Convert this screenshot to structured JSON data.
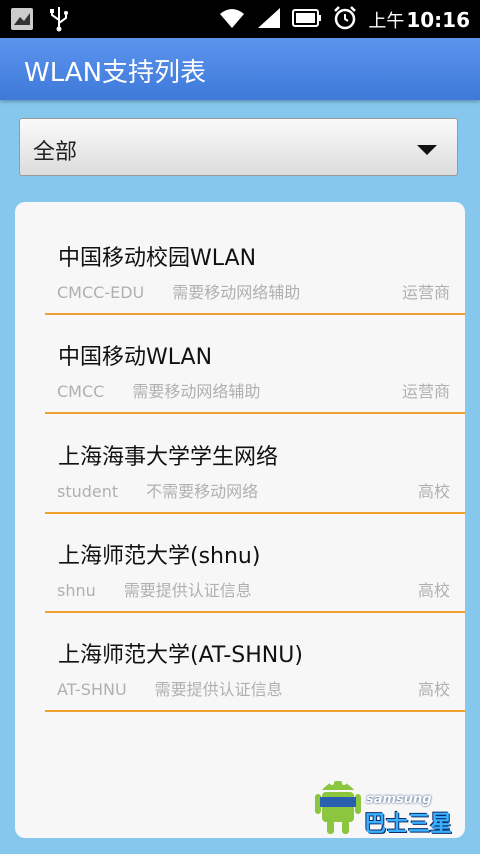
{
  "status_bar": {
    "ampm": "上午",
    "time": "10:16",
    "icons": [
      "notification-icon",
      "usb-icon",
      "wifi-icon",
      "signal-icon",
      "battery-icon",
      "alarm-icon"
    ]
  },
  "header": {
    "title": "WLAN支持列表"
  },
  "filter": {
    "selected": "全部"
  },
  "networks": [
    {
      "name": "中国移动校园WLAN",
      "ssid": "CMCC-EDU",
      "desc": "需要移动网络辅助",
      "type": "运营商"
    },
    {
      "name": "中国移动WLAN",
      "ssid": "CMCC",
      "desc": "需要移动网络辅助",
      "type": "运营商"
    },
    {
      "name": "上海海事大学学生网络",
      "ssid": "student",
      "desc": "不需要移动网络",
      "type": "高校"
    },
    {
      "name": "上海师范大学(shnu)",
      "ssid": "shnu",
      "desc": "需要提供认证信息",
      "type": "高校"
    },
    {
      "name": "上海师范大学(AT-SHNU)",
      "ssid": "AT-SHNU",
      "desc": "需要提供认证信息",
      "type": "高校"
    }
  ],
  "watermark": {
    "text1": "samsung",
    "text2": "巴士三星"
  },
  "colors": {
    "accent": "#f0a030",
    "title_bar": "#4a84e2",
    "background": "#86c7ee"
  }
}
